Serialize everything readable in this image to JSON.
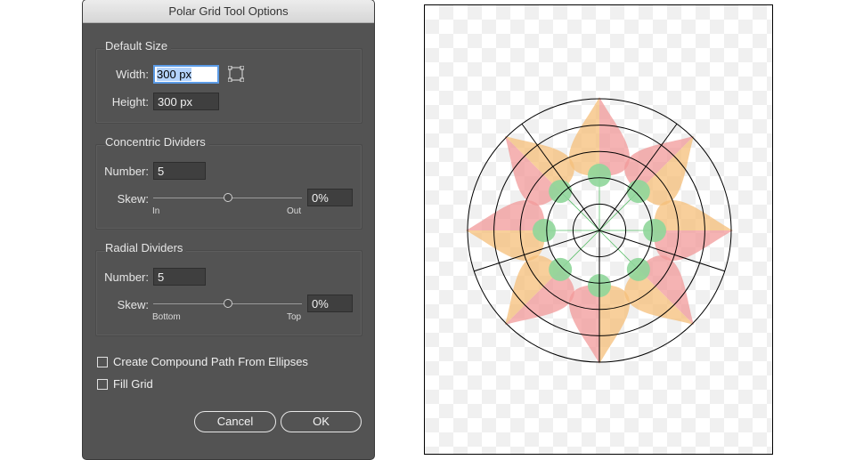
{
  "dialog": {
    "title": "Polar Grid Tool Options",
    "default_size": {
      "title": "Default Size",
      "width_label": "Width:",
      "width_value": "300 px",
      "height_label": "Height:",
      "height_value": "300 px"
    },
    "concentric": {
      "title": "Concentric Dividers",
      "number_label": "Number:",
      "number_value": "5",
      "skew_label": "Skew:",
      "skew_value": "0%",
      "skew_level": 0.5,
      "min_label": "In",
      "max_label": "Out"
    },
    "radial": {
      "title": "Radial Dividers",
      "number_label": "Number:",
      "number_value": "5",
      "skew_label": "Skew:",
      "skew_value": "0%",
      "skew_level": 0.5,
      "min_label": "Bottom",
      "max_label": "Top"
    },
    "compound_path": {
      "label": "Create Compound Path From Ellipses",
      "checked": false
    },
    "fill_grid": {
      "label": "Fill Grid",
      "checked": false
    },
    "cancel_label": "Cancel",
    "ok_label": "OK"
  },
  "artwork": {
    "ring_count": 5,
    "radial_count": 5,
    "petal_count": 8,
    "dot_count": 8,
    "colors": {
      "petal_orange": "#f5bf7a",
      "petal_pink": "#f29a9a",
      "dot_green": "#8fd69a",
      "line": "#000000",
      "guide_green": "#5cbf6b"
    }
  }
}
